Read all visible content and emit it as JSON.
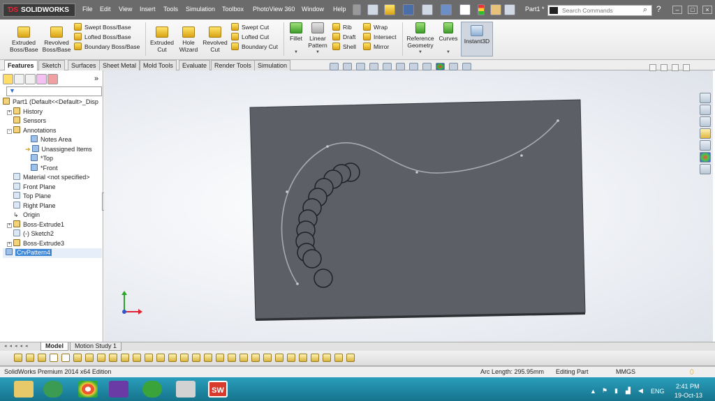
{
  "app": {
    "logo": "SOLIDWORKS",
    "document_title": "Part1 *"
  },
  "menu": [
    "File",
    "Edit",
    "View",
    "Insert",
    "Tools",
    "Simulation",
    "Toolbox",
    "PhotoView 360",
    "Window",
    "Help"
  ],
  "search": {
    "placeholder": "Search Commands"
  },
  "ribbon": {
    "extruded_boss": "Extruded\nBoss/Base",
    "revolved_boss": "Revolved\nBoss/Base",
    "swept_boss": "Swept Boss/Base",
    "lofted_boss": "Lofted Boss/Base",
    "boundary_boss": "Boundary Boss/Base",
    "extruded_cut": "Extruded\nCut",
    "hole_wizard": "Hole\nWizard",
    "revolved_cut": "Revolved\nCut",
    "swept_cut": "Swept Cut",
    "lofted_cut": "Lofted Cut",
    "boundary_cut": "Boundary Cut",
    "fillet": "Fillet",
    "linear_pattern": "Linear\nPattern",
    "rib": "Rib",
    "draft": "Draft",
    "shell": "Shell",
    "wrap": "Wrap",
    "intersect": "Intersect",
    "mirror": "Mirror",
    "reference_geometry": "Reference\nGeometry",
    "curves": "Curves",
    "instant3d": "Instant3D"
  },
  "tabs": [
    "Features",
    "Sketch",
    "Surfaces",
    "Sheet Metal",
    "Mold Tools",
    "Evaluate",
    "Render Tools",
    "Simulation"
  ],
  "tree": {
    "root": "Part1  (Default<<Default>_Disp",
    "history": "History",
    "sensors": "Sensors",
    "annotations": "Annotations",
    "notes_area": "Notes Area",
    "unassigned_items": "Unassigned Items",
    "top": "*Top",
    "front": "*Front",
    "material": "Material <not specified>",
    "front_plane": "Front Plane",
    "top_plane": "Top Plane",
    "right_plane": "Right Plane",
    "origin": "Origin",
    "boss_extrude1": "Boss-Extrude1",
    "sketch2": "(-) Sketch2",
    "boss_extrude3": "Boss-Extrude3",
    "crv_pattern4": "CrvPattern4"
  },
  "bottom_tabs": {
    "model": "Model",
    "motion": "Motion Study 1"
  },
  "status": {
    "edition": "SolidWorks Premium 2014 x64 Edition",
    "arc_length": "Arc Length: 295.95mm",
    "mode": "Editing Part",
    "units": "MMGS"
  },
  "tray": {
    "lang": "ENG",
    "time": "2:41 PM",
    "date": "19-Oct-13"
  },
  "colors": {
    "ribbon_bg": "#ececec",
    "part_face": "#5f6369",
    "selection": "#3d86d6",
    "taskbar": "#1d8aa5"
  }
}
